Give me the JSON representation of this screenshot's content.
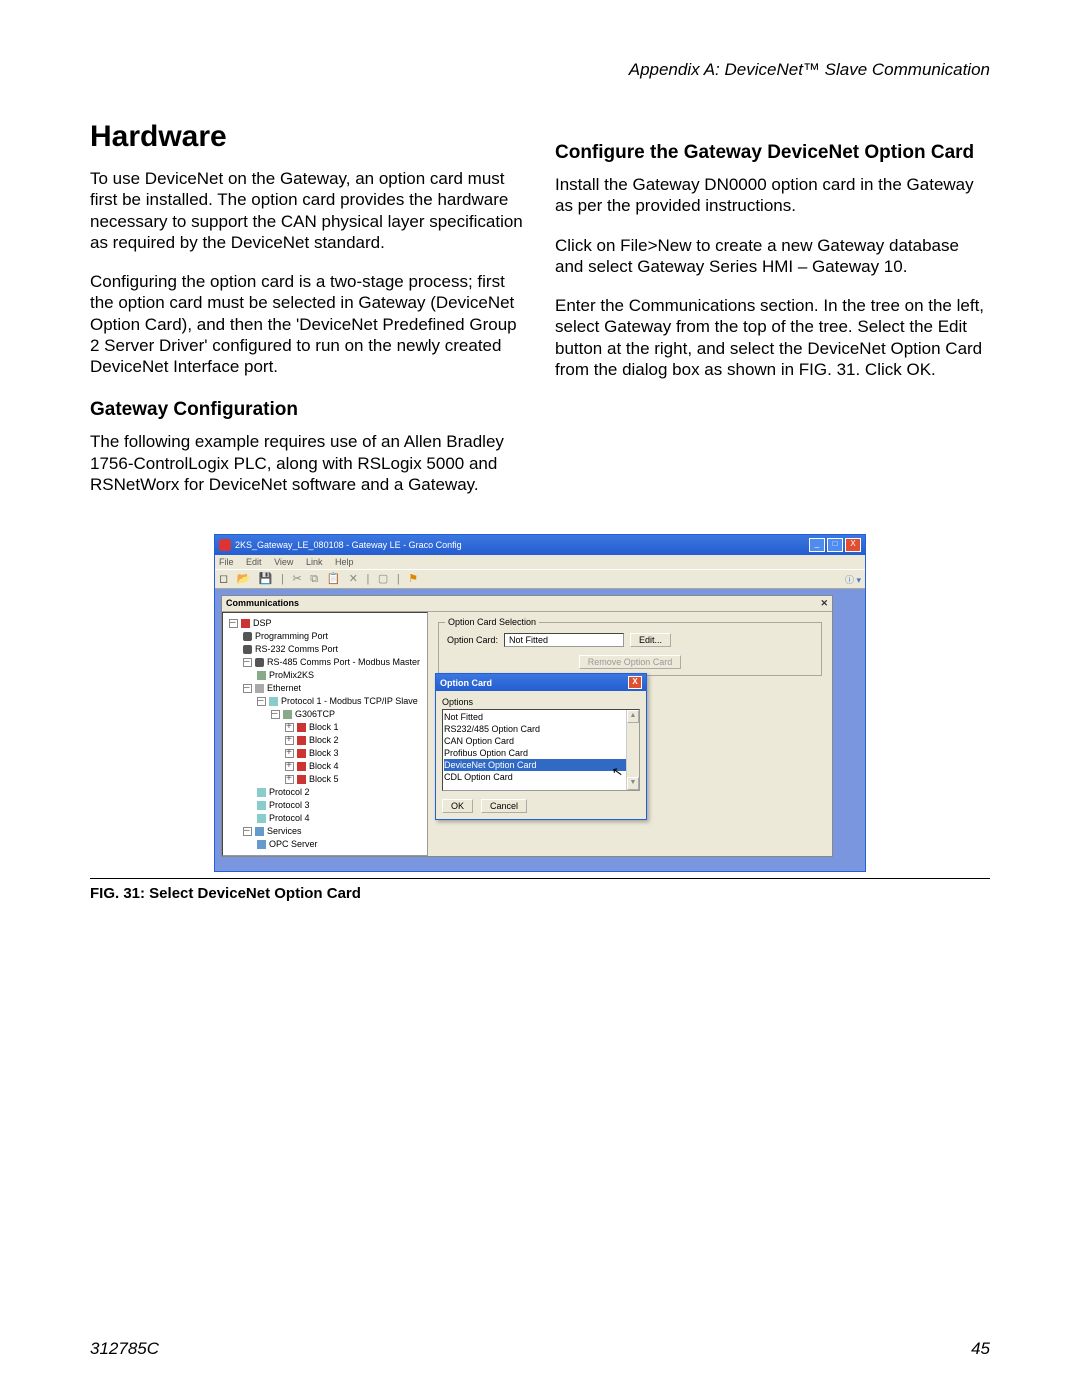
{
  "header": "Appendix A: DeviceNet™ Slave Communication",
  "h1": "Hardware",
  "col_left": {
    "p1": "To use DeviceNet on the Gateway, an option card must first be installed. The option card provides the hardware necessary to support the CAN physical layer specification as required by the DeviceNet standard.",
    "p2": "Configuring the option card is a two-stage process; first the option card must be selected in Gateway (DeviceNet Option Card), and then the 'DeviceNet Predefined Group 2 Server Driver' configured to run on the newly created DeviceNet Interface port.",
    "h2": "Gateway Configuration",
    "p3": "The following example requires use of an Allen Bradley 1756-ControlLogix PLC, along with RSLogix 5000 and RSNetWorx for DeviceNet software and a Gateway."
  },
  "col_right": {
    "h2": "Configure the Gateway DeviceNet Option Card",
    "p1": "Install the Gateway DN0000 option card in the Gateway as per the provided instructions.",
    "p2": "Click on File>New to create a new Gateway database and select Gateway Series HMI – Gateway 10.",
    "p3": "Enter the Communications section. In the tree on the left, select Gateway from the top of the tree. Select the Edit button at the right, and select the DeviceNet Option Card from the dialog box as shown in FIG. 31. Click OK."
  },
  "figure_caption": "FIG. 31: Select DeviceNet Option Card",
  "footer": {
    "doc": "312785C",
    "page": "45"
  },
  "window": {
    "title": "2KS_Gateway_LE_080108 - Gateway LE - Graco Config",
    "menu": [
      "File",
      "Edit",
      "View",
      "Link",
      "Help"
    ],
    "panel_title": "Communications",
    "tree": {
      "root": "DSP",
      "items": [
        "Programming Port",
        "RS-232 Comms Port",
        "RS-485 Comms Port - Modbus Master",
        "ProMix2KS",
        "Ethernet",
        "Protocol 1 - Modbus TCP/IP Slave",
        "G306TCP",
        "Block 1",
        "Block 2",
        "Block 3",
        "Block 4",
        "Block 5",
        "Protocol 2",
        "Protocol 3",
        "Protocol 4",
        "Services",
        "OPC Server"
      ]
    },
    "fieldset": {
      "legend": "Option Card Selection",
      "label": "Option Card:",
      "value": "Not Fitted",
      "edit_btn": "Edit...",
      "remove_btn": "Remove Option Card"
    },
    "dialog": {
      "title": "Option Card",
      "options_label": "Options",
      "list": [
        "Not Fitted",
        "RS232/485 Option Card",
        "CAN Option Card",
        "Profibus Option Card",
        "DeviceNet Option Card",
        "CDL Option Card"
      ],
      "selected_index": 4,
      "ok": "OK",
      "cancel": "Cancel"
    }
  }
}
